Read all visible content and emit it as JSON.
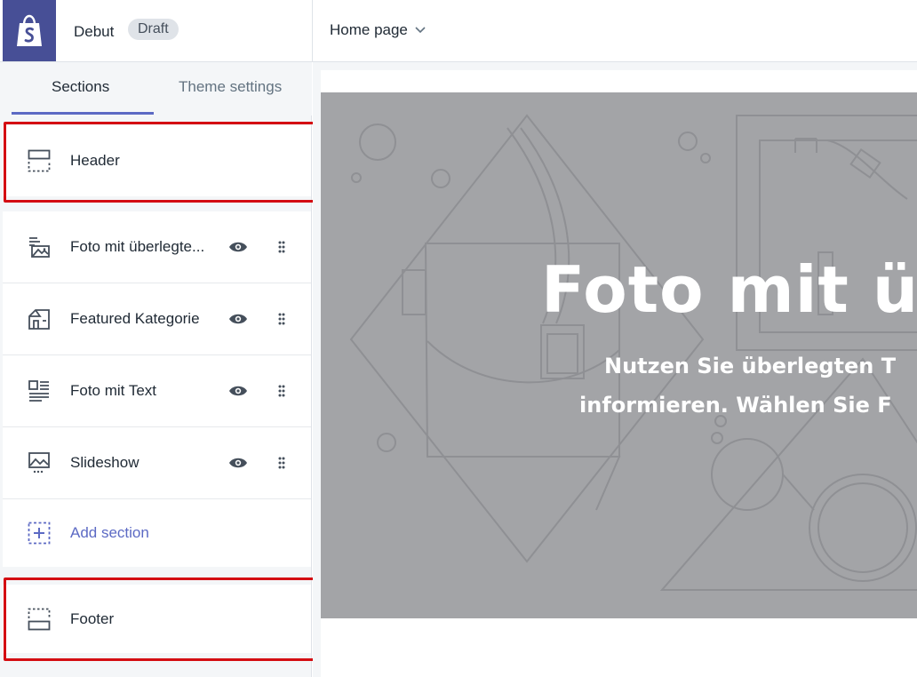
{
  "topbar": {
    "theme_name": "Debut",
    "status_badge": "Draft",
    "page_selector": "Home page"
  },
  "sidebar": {
    "tabs": [
      {
        "label": "Sections",
        "active": true
      },
      {
        "label": "Theme settings",
        "active": false
      }
    ],
    "header_section": {
      "label": "Header",
      "icon": "header-layout-icon"
    },
    "sections": [
      {
        "label": "Foto mit überlegte...",
        "icon": "image-overlay-icon"
      },
      {
        "label": "Featured Kategorie",
        "icon": "collection-icon"
      },
      {
        "label": "Foto mit Text",
        "icon": "image-text-icon"
      },
      {
        "label": "Slideshow",
        "icon": "slideshow-icon"
      }
    ],
    "add_section_label": "Add section",
    "footer_section": {
      "label": "Footer",
      "icon": "footer-layout-icon"
    }
  },
  "preview": {
    "hero_title": "Foto mit ül",
    "hero_subtitle_line1": "Nutzen Sie überlegten T",
    "hero_subtitle_line2": "informieren. Wählen Sie F"
  },
  "colors": {
    "accent": "#5c6ac4",
    "logo_bg": "#474f96",
    "highlight_border": "#d40d12",
    "hero_bg": "#a3a4a7"
  }
}
